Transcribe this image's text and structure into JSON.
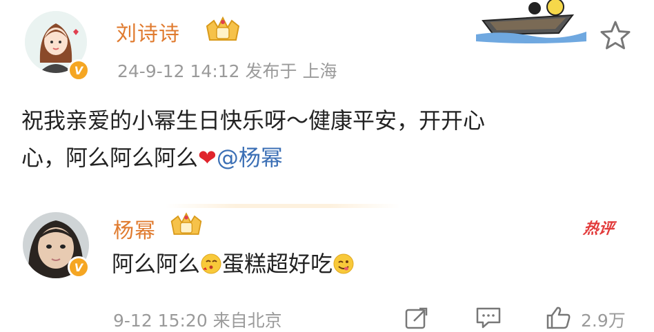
{
  "post": {
    "author": "刘诗诗",
    "meta": "24-9-12 14:12  发布于 上海",
    "content_line1": "祝我亲爱的小幂生日快乐呀～健康平安，开开心",
    "content_line2_prefix": "心，阿么阿么阿么",
    "mention": "@杨幂"
  },
  "reply": {
    "author": "杨幂",
    "text_part1": "阿么阿么",
    "text_part2": "蛋糕超好吃",
    "hot_badge": "热评",
    "time": "9-12 15:20  来自北京",
    "like_count": "2.9万"
  },
  "colors": {
    "name": "#e07b2f",
    "mention": "#3b6fb5",
    "meta": "#9a9a9a",
    "hot": "#e23a3a",
    "badge": "#f5a623"
  },
  "icons": [
    "boat-illustration",
    "star-icon",
    "crown-badge-icon",
    "verified-v-icon",
    "kiss-emoji-icon",
    "yummy-emoji-icon",
    "heart-icon",
    "share-icon",
    "comment-icon",
    "like-icon"
  ]
}
